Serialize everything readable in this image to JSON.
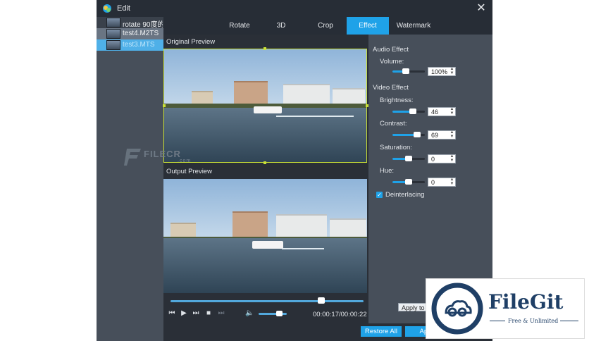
{
  "window": {
    "title": "Edit"
  },
  "files": [
    {
      "name": "rotate 90度的..."
    },
    {
      "name": "test4.M2TS"
    },
    {
      "name": "test3.MTS"
    }
  ],
  "tabs": [
    "Rotate",
    "3D",
    "Crop",
    "Effect",
    "Watermark"
  ],
  "active_tab": "Effect",
  "preview": {
    "original_label": "Original Preview",
    "output_label": "Output Preview",
    "progress": 0.78,
    "volume": 0.72,
    "time": "00:00:17/00:00:22"
  },
  "effect": {
    "audio_heading": "Audio Effect",
    "volume_label": "Volume:",
    "volume_value": "100%",
    "volume_level": 0.45,
    "video_heading": "Video Effect",
    "brightness_label": "Brightness:",
    "brightness_value": "46",
    "contrast_label": "Contrast:",
    "contrast_value": "69",
    "saturation_label": "Saturation:",
    "saturation_value": "0",
    "hue_label": "Hue:",
    "hue_value": "0",
    "deinterlacing_label": "Deinterlacing",
    "deinterlacing_checked": true
  },
  "buttons": {
    "apply_to_all": "Apply to",
    "restore_all": "Restore All",
    "apply": "App"
  },
  "watermarks": {
    "filecr": "FILECR",
    "filecr_sub": ".com",
    "filegit": "FileGit",
    "filegit_tag": "Free & Unlimited"
  },
  "colors": {
    "accent": "#1fa2e8",
    "crop_frame": "#c9e036",
    "brand": "#1f3f66"
  }
}
